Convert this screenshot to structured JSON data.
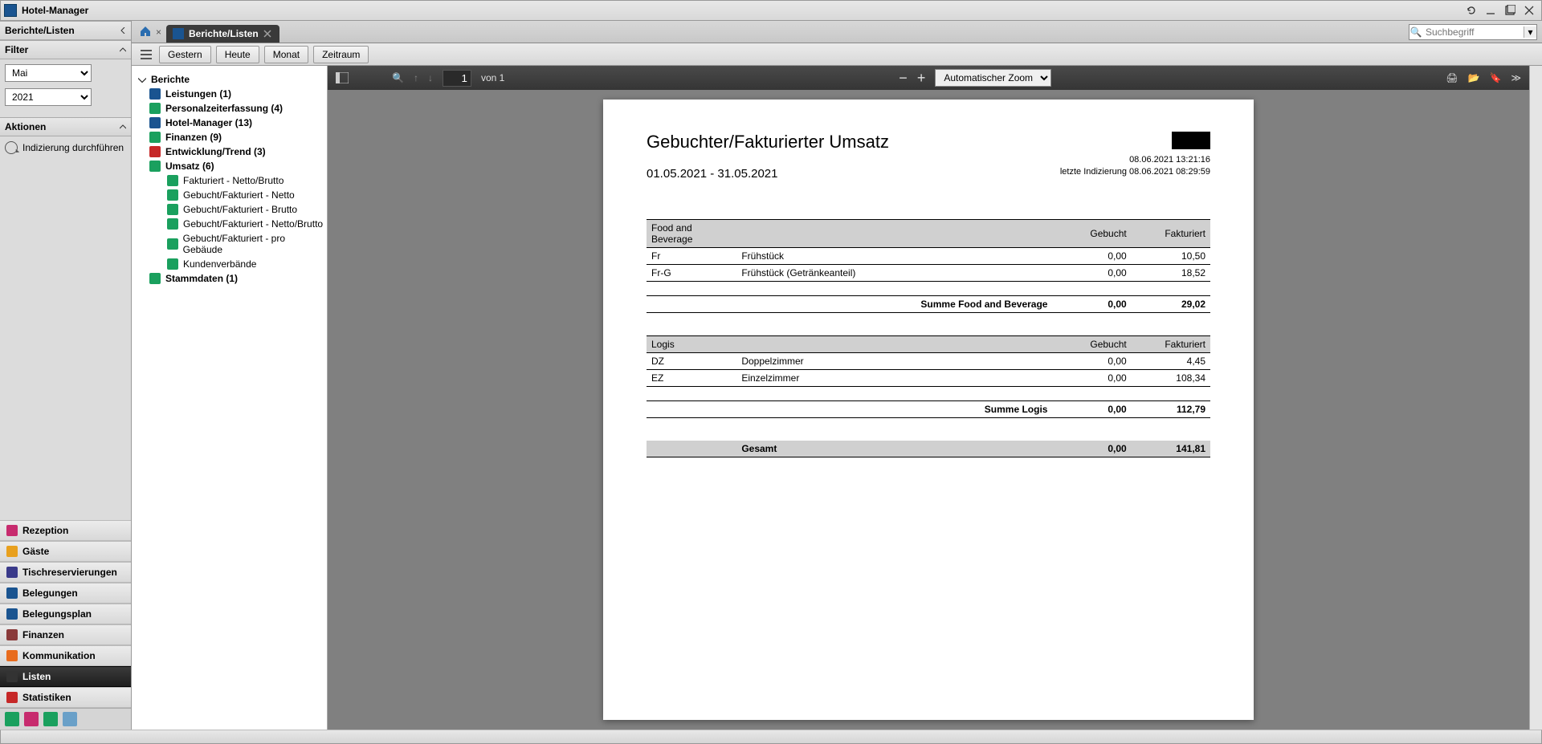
{
  "window": {
    "title": "Hotel-Manager"
  },
  "sidebar": {
    "section_title": "Berichte/Listen",
    "filter_title": "Filter",
    "filter_month": "Mai",
    "filter_year": "2021",
    "actions_title": "Aktionen",
    "action_index": "Indizierung durchführen",
    "nav": [
      {
        "label": "Rezeption",
        "color": "#c72b6e"
      },
      {
        "label": "Gäste",
        "color": "#e8a01e"
      },
      {
        "label": "Tischreservierungen",
        "color": "#3a3a8a"
      },
      {
        "label": "Belegungen",
        "color": "#1a5490"
      },
      {
        "label": "Belegungsplan",
        "color": "#1a5490"
      },
      {
        "label": "Finanzen",
        "color": "#8a3a3a"
      },
      {
        "label": "Kommunikation",
        "color": "#e86c1e"
      },
      {
        "label": "Listen",
        "color": "#333333",
        "active": true
      },
      {
        "label": "Statistiken",
        "color": "#c62828"
      }
    ]
  },
  "tabs": {
    "home_x": "×",
    "active": {
      "label": "Berichte/Listen"
    }
  },
  "search_placeholder": "Suchbegriff",
  "toolbar": {
    "gestern": "Gestern",
    "heute": "Heute",
    "monat": "Monat",
    "zeitraum": "Zeitraum"
  },
  "tree": {
    "root": "Berichte",
    "items": [
      {
        "label": "Leistungen (1)",
        "color": "#1a5490"
      },
      {
        "label": "Personalzeiterfassung (4)",
        "color": "#1aa05e"
      },
      {
        "label": "Hotel-Manager (13)",
        "color": "#1a5490"
      },
      {
        "label": "Finanzen (9)",
        "color": "#1aa05e"
      },
      {
        "label": "Entwicklung/Trend (3)",
        "color": "#c62828"
      },
      {
        "label": "Umsatz (6)",
        "color": "#1aa05e",
        "expanded": true,
        "children": [
          {
            "label": "Fakturiert - Netto/Brutto"
          },
          {
            "label": "Gebucht/Fakturiert - Netto"
          },
          {
            "label": "Gebucht/Fakturiert - Brutto"
          },
          {
            "label": "Gebucht/Fakturiert - Netto/Brutto"
          },
          {
            "label": "Gebucht/Fakturiert - pro Gebäude"
          },
          {
            "label": "Kundenverbände"
          }
        ]
      },
      {
        "label": "Stammdaten (1)",
        "color": "#1aa05e"
      }
    ]
  },
  "viewer": {
    "page_current": "1",
    "page_of": "von 1",
    "zoom": "Automatischer Zoom"
  },
  "report": {
    "title": "Gebuchter/Fakturierter Umsatz",
    "date_range": "01.05.2021 - 31.05.2021",
    "printed": "08.06.2021 13:21:16",
    "indexed": "letzte Indizierung 08.06.2021 08:29:59",
    "sections": [
      {
        "name": "Food and Beverage",
        "col_booked": "Gebucht",
        "col_invoiced": "Fakturiert",
        "rows": [
          {
            "code": "Fr",
            "name": "Frühstück",
            "booked": "0,00",
            "invoiced": "10,50"
          },
          {
            "code": "Fr-G",
            "name": "Frühstück (Getränkeanteil)",
            "booked": "0,00",
            "invoiced": "18,52"
          }
        ],
        "sum_label": "Summe Food and Beverage",
        "sum_booked": "0,00",
        "sum_invoiced": "29,02"
      },
      {
        "name": "Logis",
        "col_booked": "Gebucht",
        "col_invoiced": "Fakturiert",
        "rows": [
          {
            "code": "DZ",
            "name": "Doppelzimmer",
            "booked": "0,00",
            "invoiced": "4,45"
          },
          {
            "code": "EZ",
            "name": "Einzelzimmer",
            "booked": "0,00",
            "invoiced": "108,34"
          }
        ],
        "sum_label": "Summe Logis",
        "sum_booked": "0,00",
        "sum_invoiced": "112,79"
      }
    ],
    "grand_label": "Gesamt",
    "grand_booked": "0,00",
    "grand_invoiced": "141,81"
  }
}
